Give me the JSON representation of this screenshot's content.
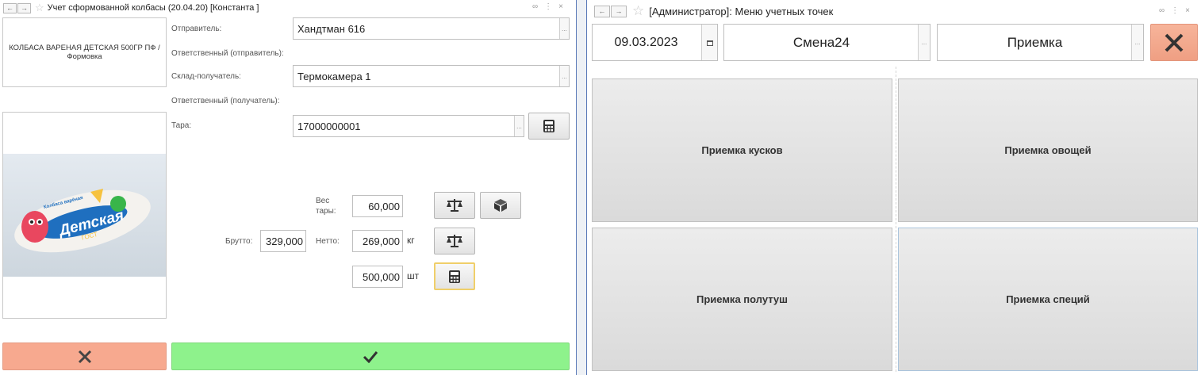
{
  "left": {
    "title": "Учет сформованной колбасы (20.04.20) [Константа ]",
    "product_name": "КОЛБАСА ВАРЕНАЯ ДЕТСКАЯ 500ГР ПФ / Формовка",
    "product_image": {
      "brand_text": "Детская",
      "sub_text": "ГОСТ",
      "top_text": "Колбаса варёная"
    },
    "fields": {
      "sender_label": "Отправитель:",
      "sender_value": "Хандтман 616",
      "sender_resp_label": "Ответственный (отправитель):",
      "warehouse_label": "Склад-получатель:",
      "warehouse_value": "Термокамера 1",
      "receiver_resp_label": "Ответственный (получатель):",
      "tara_label": "Тара:",
      "tara_value": "17000000001"
    },
    "weights": {
      "tare_label": "Вес тары:",
      "tare_value": "60,000",
      "brutto_label": "Брутто:",
      "brutto_value": "329,000",
      "netto_label": "Нетто:",
      "netto_value": "269,000",
      "netto_unit": "кг",
      "pieces_value": "500,000",
      "pieces_unit": "шт"
    },
    "footer": {
      "cancel_color": "#f7a98f",
      "ok_color": "#8ef28c"
    }
  },
  "right": {
    "title": "[Администратор]: Меню учетных точек",
    "date": "09.03.2023",
    "shift": "Смена24",
    "mode": "Приемка",
    "tiles": [
      "Приемка кусков",
      "Приемка овощей",
      "Приемка полутуш",
      "Приемка специй"
    ]
  },
  "icons": {
    "scales": "scales-icon",
    "box": "box-icon",
    "calculator": "calculator-icon",
    "close": "close-icon",
    "check": "check-icon"
  }
}
